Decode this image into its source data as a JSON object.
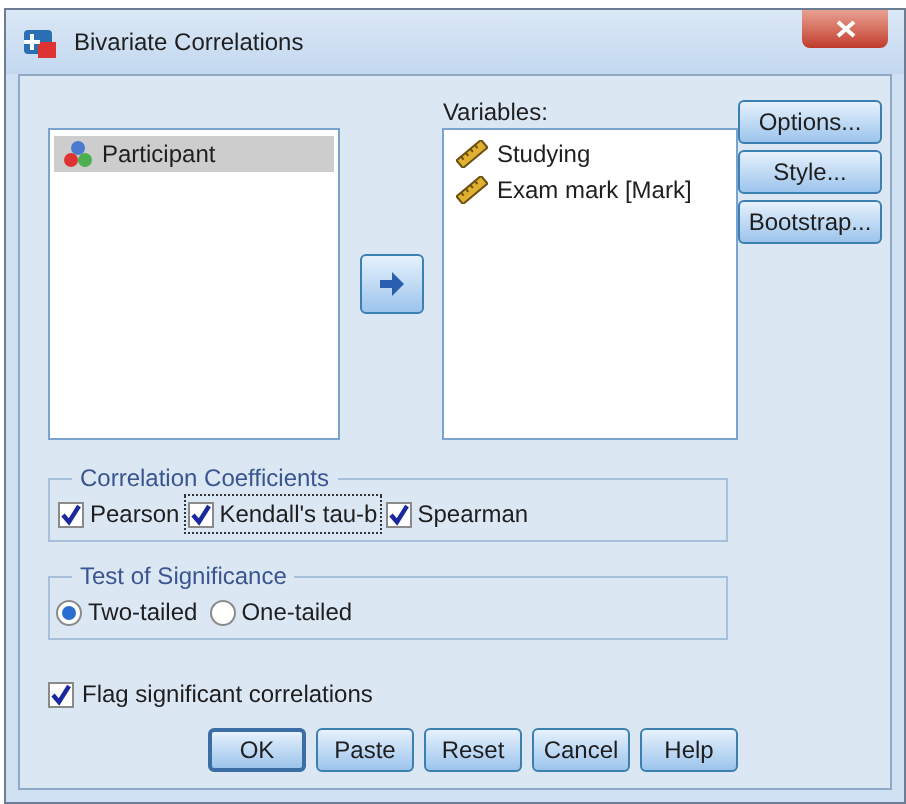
{
  "window": {
    "title": "Bivariate Correlations"
  },
  "source_list": {
    "items": [
      {
        "label": "Participant",
        "kind": "nominal",
        "selected": true
      }
    ]
  },
  "variables": {
    "label": "Variables:",
    "items": [
      {
        "label": "Studying",
        "kind": "scale",
        "selected": false
      },
      {
        "label": "Exam mark [Mark]",
        "kind": "scale",
        "selected": false
      }
    ]
  },
  "side_buttons": [
    "Options...",
    "Style...",
    "Bootstrap..."
  ],
  "correlation_coefficients": {
    "title": "Correlation Coefficients",
    "options": [
      {
        "label": "Pearson",
        "checked": true,
        "focused": false
      },
      {
        "label": "Kendall's tau-b",
        "checked": true,
        "focused": true
      },
      {
        "label": "Spearman",
        "checked": true,
        "focused": false
      }
    ]
  },
  "test_of_significance": {
    "title": "Test of Significance",
    "options": [
      {
        "label": "Two-tailed",
        "selected": true
      },
      {
        "label": "One-tailed",
        "selected": false
      }
    ]
  },
  "flag": {
    "label": "Flag significant correlations",
    "checked": true
  },
  "buttons": [
    {
      "label": "OK",
      "default": true
    },
    {
      "label": "Paste",
      "default": false
    },
    {
      "label": "Reset",
      "default": false
    },
    {
      "label": "Cancel",
      "default": false
    },
    {
      "label": "Help",
      "default": false
    }
  ]
}
